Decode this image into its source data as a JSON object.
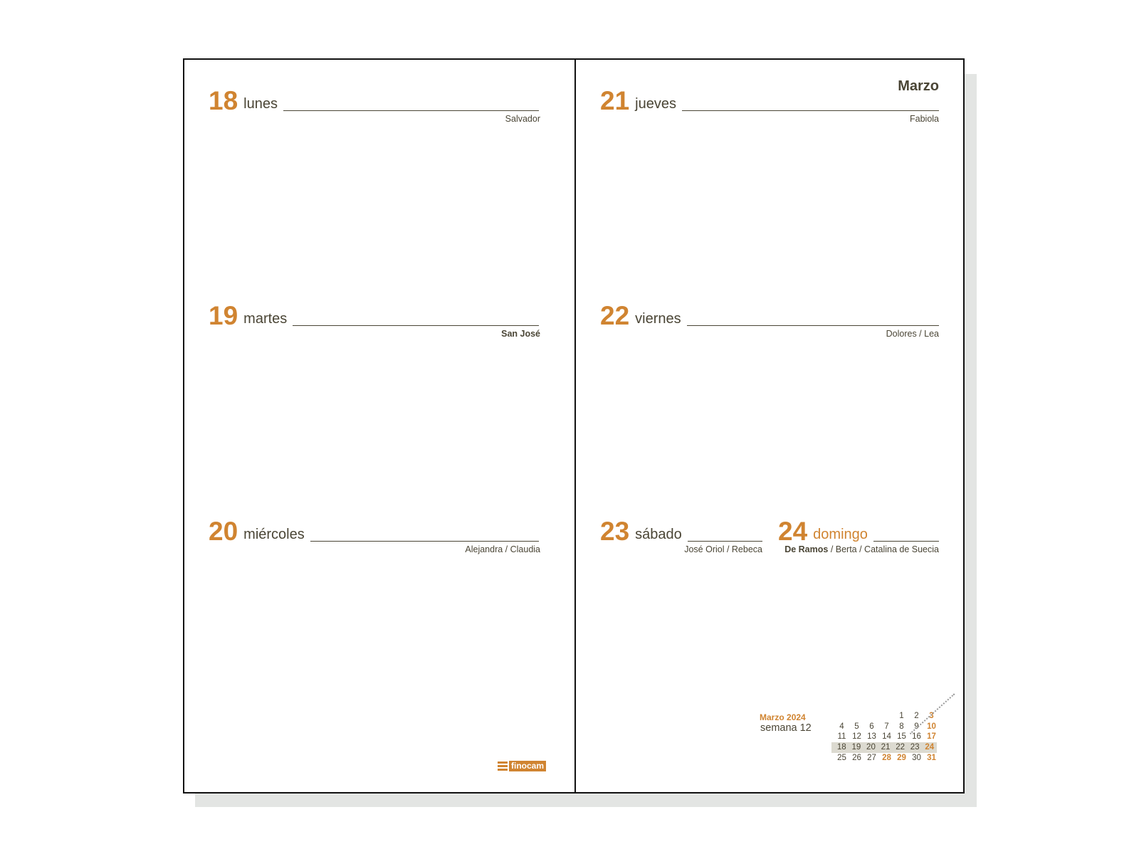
{
  "month_heading": "Marzo",
  "days": [
    {
      "num": "18",
      "name": "lunes",
      "saint": "Salvador"
    },
    {
      "num": "19",
      "name": "martes",
      "saint": "San José",
      "saint_bold": true
    },
    {
      "num": "20",
      "name": "miércoles",
      "saint": "Alejandra / Claudia"
    },
    {
      "num": "21",
      "name": "jueves",
      "saint": "Fabiola"
    },
    {
      "num": "22",
      "name": "viernes",
      "saint": "Dolores / Lea"
    },
    {
      "num": "23",
      "name": "sábado",
      "saint": "José Oriol / Rebeca"
    },
    {
      "num": "24",
      "name": "domingo",
      "saint_bold_part": "De Ramos",
      "saint": " / Berta / Catalina de Suecia"
    }
  ],
  "logo": "finocam",
  "mini_calendar": {
    "month": "Marzo",
    "year": "2024",
    "week_label": "semana 12",
    "rows": [
      [
        "",
        "",
        "",
        "",
        "1",
        "2",
        "3"
      ],
      [
        "4",
        "5",
        "6",
        "7",
        "8",
        "9",
        "10"
      ],
      [
        "11",
        "12",
        "13",
        "14",
        "15",
        "16",
        "17"
      ],
      [
        "18",
        "19",
        "20",
        "21",
        "22",
        "23",
        "24"
      ],
      [
        "25",
        "26",
        "27",
        "28",
        "29",
        "30",
        "31"
      ]
    ],
    "highlighted_row": 3,
    "orange_dates": [
      "3",
      "10",
      "17",
      "24",
      "28",
      "29",
      "31"
    ]
  },
  "colors": {
    "accent": "#d08431",
    "text": "#4a4535",
    "highlight": "#dcdad0"
  }
}
